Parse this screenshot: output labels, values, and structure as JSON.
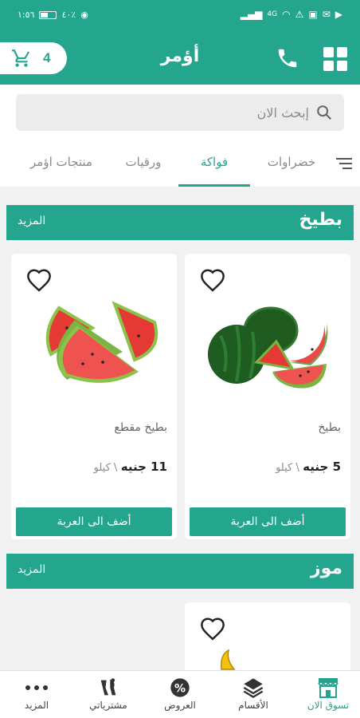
{
  "status_bar": {
    "time": "١:٥٦",
    "battery": "٤٠٪",
    "net": "4G"
  },
  "header": {
    "title": "أؤمر",
    "cart_count": "4"
  },
  "search": {
    "placeholder": "إبحث الان"
  },
  "tabs": [
    {
      "label": "خضراوات",
      "active": false
    },
    {
      "label": "فواكة",
      "active": true
    },
    {
      "label": "ورقيات",
      "active": false
    },
    {
      "label": "منتجات اؤمر",
      "active": false
    }
  ],
  "sections": [
    {
      "title": "بطيخ",
      "more_label": "المزيد",
      "products": [
        {
          "name": "بطيخ",
          "price": "5 جنيه",
          "unit": "\\ كيلو",
          "add_label": "أضف الى العربة",
          "image": "whole-watermelon-icon"
        },
        {
          "name": "بطيخ مقطع",
          "price": "11 جنيه",
          "unit": "\\ كيلو",
          "add_label": "أضف الى العربة",
          "image": "sliced-watermelon-icon"
        }
      ]
    },
    {
      "title": "موز",
      "more_label": "المزيد",
      "products": []
    }
  ],
  "bottom_nav": [
    {
      "label": "تسوق الان",
      "icon": "store-icon",
      "active": true
    },
    {
      "label": "الأقسام",
      "icon": "layers-icon",
      "active": false
    },
    {
      "label": "العروض",
      "icon": "percent-badge-icon",
      "active": false
    },
    {
      "label": "مشترياتي",
      "icon": "purchases-icon",
      "active": false
    },
    {
      "label": "المزيد",
      "icon": "more-dots-icon",
      "active": false
    }
  ],
  "colors": {
    "brand": "#24a58d",
    "background": "#f1f1f1"
  }
}
